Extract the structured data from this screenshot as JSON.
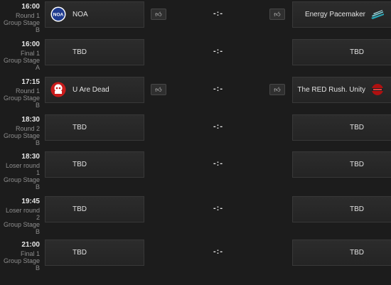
{
  "matches": [
    {
      "time": "16:00",
      "round_line1": "Round 1",
      "round_line2": "",
      "stage_line1": "Group Stage",
      "stage_line2": "B",
      "left_team": "NOA",
      "left_logo_text": "NOA",
      "left_logo": "noa-logo",
      "right_team": "Energy Pacemaker",
      "right_logo": "energy-pacemaker-logo",
      "score": "-:-",
      "vote_icon": "thumbs-up-icon"
    },
    {
      "time": "16:00",
      "round_line1": "Final 1",
      "round_line2": "",
      "stage_line1": "Group Stage",
      "stage_line2": "A",
      "left_team": "TBD",
      "right_team": "TBD",
      "score": "-:-"
    },
    {
      "time": "17:15",
      "round_line1": "Round 1",
      "round_line2": "",
      "stage_line1": "Group Stage",
      "stage_line2": "B",
      "left_team": "U Are Dead",
      "left_logo": "u-are-dead-logo",
      "right_team": "The RED Rush. Unity",
      "right_logo": "red-rush-logo",
      "score": "-:-",
      "vote_icon": "thumbs-up-icon"
    },
    {
      "time": "18:30",
      "round_line1": "Round 2",
      "round_line2": "",
      "stage_line1": "Group Stage",
      "stage_line2": "B",
      "left_team": "TBD",
      "right_team": "TBD",
      "score": "-:-"
    },
    {
      "time": "18:30",
      "round_line1": "Loser round",
      "round_line2": "1",
      "stage_line1": "Group Stage",
      "stage_line2": "B",
      "left_team": "TBD",
      "right_team": "TBD",
      "score": "-:-"
    },
    {
      "time": "19:45",
      "round_line1": "Loser round",
      "round_line2": "2",
      "stage_line1": "Group Stage",
      "stage_line2": "B",
      "left_team": "TBD",
      "right_team": "TBD",
      "score": "-:-"
    },
    {
      "time": "21:00",
      "round_line1": "Final 1",
      "round_line2": "",
      "stage_line1": "Group Stage",
      "stage_line2": "B",
      "left_team": "TBD",
      "right_team": "TBD",
      "score": "-:-"
    }
  ],
  "colors": {
    "background": "#1c1c1c",
    "card": "#2a2a2a",
    "noa_blue": "#1f3b8f",
    "u_are_dead_red": "#c91c1c",
    "energy_teal": "#2aa8b8",
    "red_rush_red": "#b01010"
  }
}
